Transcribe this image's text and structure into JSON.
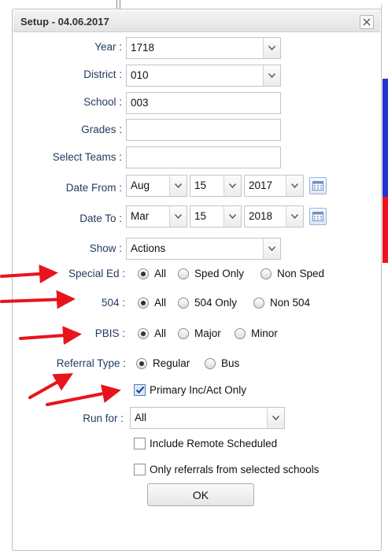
{
  "dialog": {
    "title": "Setup - 04.06.2017"
  },
  "fields": {
    "year": {
      "label": "Year :",
      "value": "1718"
    },
    "district": {
      "label": "District :",
      "value": "010"
    },
    "school": {
      "label": "School :",
      "value": "003"
    },
    "grades": {
      "label": "Grades :",
      "value": ""
    },
    "select_teams": {
      "label": "Select Teams :",
      "value": ""
    },
    "date_from": {
      "label": "Date From :",
      "month": "Aug",
      "day": "15",
      "year": "2017"
    },
    "date_to": {
      "label": "Date To :",
      "month": "Mar",
      "day": "15",
      "year": "2018"
    },
    "show": {
      "label": "Show :",
      "value": "Actions"
    }
  },
  "special_ed": {
    "label": "Special Ed :",
    "options": [
      "All",
      "Sped Only",
      "Non Sped"
    ],
    "selected": "All"
  },
  "section_504": {
    "label": "504 :",
    "options": [
      "All",
      "504 Only",
      "Non 504"
    ],
    "selected": "All"
  },
  "pbis": {
    "label": "PBIS :",
    "options": [
      "All",
      "Major",
      "Minor"
    ],
    "selected": "All"
  },
  "referral_type": {
    "label": "Referral Type :",
    "options": [
      "Regular",
      "Bus"
    ],
    "selected": "Regular"
  },
  "checkboxes": {
    "primary": {
      "label": "Primary Inc/Act Only",
      "checked": true
    },
    "remote": {
      "label": "Include Remote Scheduled",
      "checked": false
    },
    "selected_schools": {
      "label": "Only referrals from selected schools",
      "checked": false
    }
  },
  "run_for": {
    "label": "Run for :",
    "value": "All"
  },
  "ok_button": {
    "label": "OK"
  },
  "colors": {
    "arrow": "#e8141c",
    "label_text": "#1f3a5f",
    "side_bar_blue": "#2233cc",
    "side_bar_red": "#ee1122"
  },
  "icons": {
    "close": "close-icon",
    "dropdown": "chevron-down-icon",
    "calendar": "calendar-icon"
  }
}
